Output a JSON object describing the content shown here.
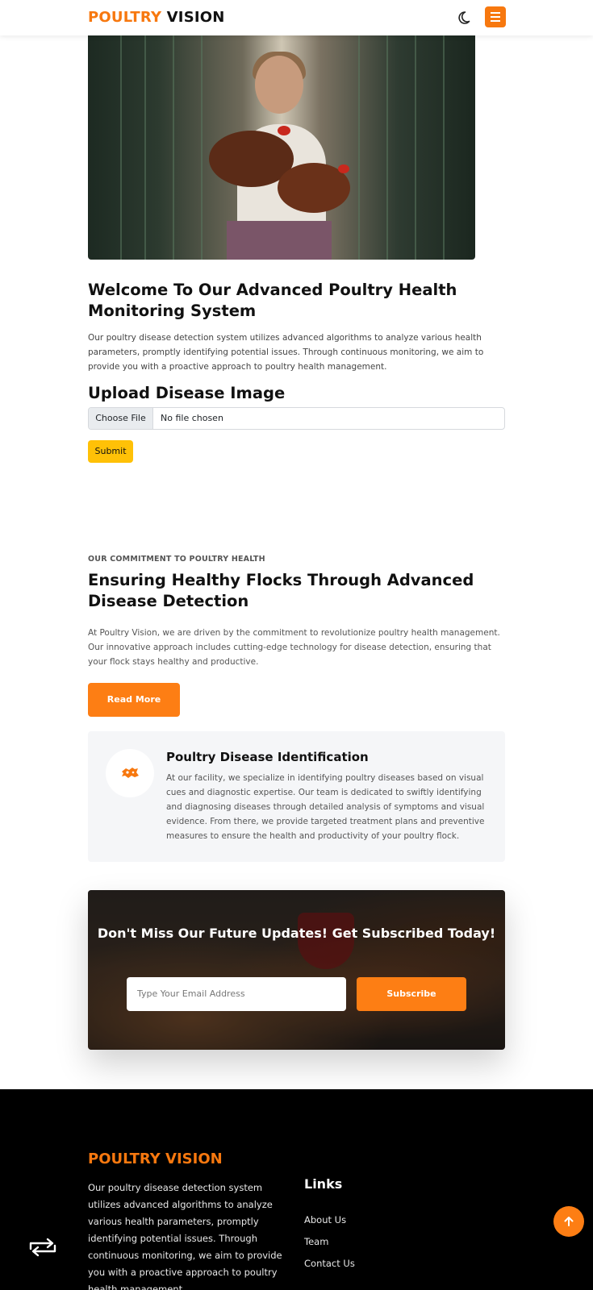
{
  "header": {
    "logo_part1": "POULTRY",
    "logo_part2": "VISION",
    "theme_icon": "moon-icon",
    "menu_icon": "hamburger-icon",
    "accent_color": "#f7780f"
  },
  "hero": {
    "heading": "Welcome To Our Advanced Poultry Health Monitoring System",
    "description": "Our poultry disease detection system utilizes advanced algorithms to analyze various health parameters, promptly identifying potential issues. Through continuous monitoring, we aim to provide you with a proactive approach to poultry health management."
  },
  "upload": {
    "heading": "Upload Disease Image",
    "choose_label": "Choose File",
    "file_status": "No file chosen",
    "submit_label": "Submit",
    "submit_color": "#ffc107"
  },
  "commitment": {
    "eyebrow": "OUR COMMITMENT TO POULTRY HEALTH",
    "heading": "Ensuring Healthy Flocks Through Advanced Disease Detection",
    "description": "At Poultry Vision, we are driven by the commitment to revolutionize poultry health management. Our innovative approach includes cutting-edge technology for disease detection, ensuring that your flock stays healthy and productive.",
    "read_more_label": "Read More"
  },
  "feature_card": {
    "icon": "chicken-icon",
    "title": "Poultry Disease Identification",
    "text": "At our facility, we specialize in identifying poultry diseases based on visual cues and diagnostic expertise. Our team is dedicated to swiftly identifying and diagnosing diseases through detailed analysis of symptoms and visual evidence. From there, we provide targeted treatment plans and preventive measures to ensure the health and productivity of your poultry flock."
  },
  "newsletter": {
    "heading": "Don't Miss Our Future Updates! Get Subscribed Today!",
    "email_placeholder": "Type Your Email Address",
    "subscribe_label": "Subscribe",
    "button_color": "#fd7e14"
  },
  "footer": {
    "logo": "POULTRY VISION",
    "about": "Our poultry disease detection system utilizes advanced algorithms to analyze various health parameters, promptly identifying potential issues. Through continuous monitoring, we aim to provide you with a proactive approach to poultry health management.",
    "links_heading": "Links",
    "links": [
      "About Us",
      "Team",
      "Contact Us"
    ]
  },
  "floating": {
    "back_to_top_icon": "arrow-up-icon",
    "swap_icon": "swap-arrows-icon"
  }
}
